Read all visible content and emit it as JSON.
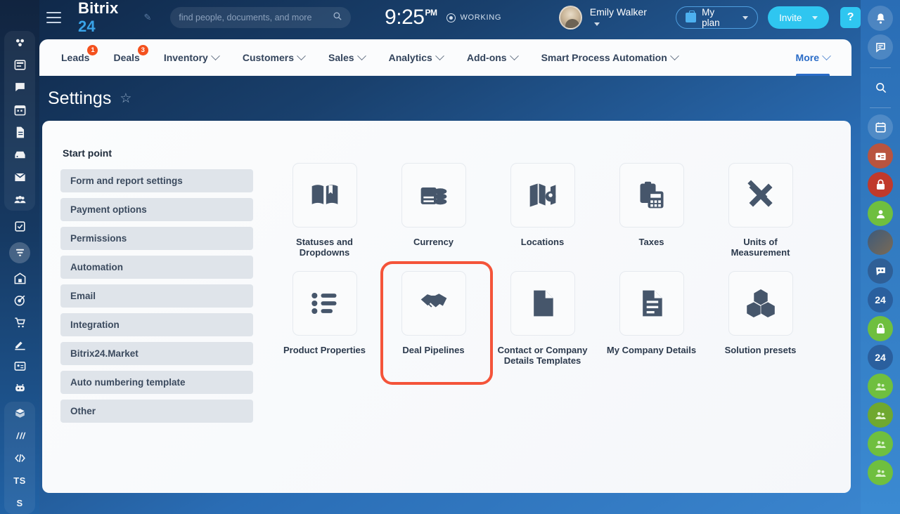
{
  "header": {
    "menu_icon": "hamburger-icon",
    "logo_text": "Bitrix",
    "logo_number": "24",
    "edit_icon": "pencil-icon",
    "search_placeholder": "find people, documents, and more",
    "search_value": "",
    "search_icon": "search-icon",
    "time": "9:25",
    "time_meridiem": "PM",
    "status_label": "WORKING",
    "status_icon": "record-dot-icon",
    "user_name": "Emily Walker",
    "avatar": "user-avatar",
    "my_plan_label": "My plan",
    "my_plan_icon": "briefcase-icon",
    "invite_label": "Invite",
    "help_label": "?"
  },
  "nav": {
    "items": [
      {
        "label": "Leads",
        "badge": "1",
        "has_dropdown": false
      },
      {
        "label": "Deals",
        "badge": "3",
        "has_dropdown": false
      },
      {
        "label": "Inventory",
        "badge": "",
        "has_dropdown": true
      },
      {
        "label": "Customers",
        "badge": "",
        "has_dropdown": true
      },
      {
        "label": "Sales",
        "badge": "",
        "has_dropdown": true
      },
      {
        "label": "Analytics",
        "badge": "",
        "has_dropdown": true
      },
      {
        "label": "Add-ons",
        "badge": "",
        "has_dropdown": true
      },
      {
        "label": "Smart Process Automation",
        "badge": "",
        "has_dropdown": true
      }
    ],
    "more_label": "More"
  },
  "page": {
    "title": "Settings",
    "favorite_icon": "star-outline-icon"
  },
  "settings_sidebar": {
    "heading": "Start point",
    "items": [
      {
        "label": "Form and report settings"
      },
      {
        "label": "Payment options"
      },
      {
        "label": "Permissions"
      },
      {
        "label": "Automation"
      },
      {
        "label": "Email"
      },
      {
        "label": "Integration"
      },
      {
        "label": "Bitrix24.Market"
      },
      {
        "label": "Auto numbering template"
      },
      {
        "label": "Other"
      }
    ]
  },
  "tiles": [
    {
      "label": "Statuses and Dropdowns",
      "icon": "open-book-icon",
      "highlighted": false
    },
    {
      "label": "Currency",
      "icon": "money-coins-icon",
      "highlighted": false
    },
    {
      "label": "Locations",
      "icon": "map-pin-icon",
      "highlighted": false
    },
    {
      "label": "Taxes",
      "icon": "clipboard-calculator-icon",
      "highlighted": false
    },
    {
      "label": "Units of Measurement",
      "icon": "ruler-pencil-icon",
      "highlighted": false
    },
    {
      "label": "Product Properties",
      "icon": "bulleted-list-icon",
      "highlighted": false
    },
    {
      "label": "Deal Pipelines",
      "icon": "handshake-icon",
      "highlighted": true
    },
    {
      "label": "Contact or Company Details Templates",
      "icon": "document-icon",
      "highlighted": false
    },
    {
      "label": "My Company Details",
      "icon": "document-lines-icon",
      "highlighted": false
    },
    {
      "label": "Solution presets",
      "icon": "cubes-icon",
      "highlighted": false
    }
  ],
  "left_rail": {
    "items": [
      {
        "icon": "bitrix-logo-icon",
        "label": ""
      },
      {
        "icon": "news-feed-icon",
        "label": ""
      },
      {
        "icon": "chat-icon",
        "label": ""
      },
      {
        "icon": "calendar-icon",
        "label": ""
      },
      {
        "icon": "document-icon",
        "label": ""
      },
      {
        "icon": "drive-icon",
        "label": ""
      },
      {
        "icon": "mail-icon",
        "label": ""
      },
      {
        "icon": "group-icon",
        "label": ""
      },
      {
        "icon": "tasks-icon",
        "label": ""
      },
      {
        "icon": "crm-funnel-icon",
        "label": ""
      },
      {
        "icon": "company-icon",
        "label": ""
      },
      {
        "icon": "target-icon",
        "label": ""
      },
      {
        "icon": "cart-icon",
        "label": ""
      },
      {
        "icon": "sign-icon",
        "label": ""
      },
      {
        "icon": "contact-card-icon",
        "label": ""
      },
      {
        "icon": "robot-icon",
        "label": ""
      },
      {
        "icon": "box-icon",
        "label": ""
      },
      {
        "icon": "analytics-icon",
        "label": ""
      },
      {
        "icon": "code-icon",
        "label": ""
      },
      {
        "icon": "ts-text-icon",
        "label": "TS"
      },
      {
        "icon": "s-text-icon",
        "label": "S"
      }
    ]
  },
  "right_rail": {
    "items": [
      {
        "icon": "bell-icon",
        "label": "",
        "color": "#ffffff"
      },
      {
        "icon": "chat-bubble-icon",
        "label": "",
        "color": "#ffffff"
      },
      {
        "icon": "search-icon",
        "label": "",
        "color": "#ffffff"
      },
      {
        "icon": "calendar-icon",
        "label": "",
        "color": "#ffffff"
      },
      {
        "icon": "contact-card-icon",
        "label": "",
        "color": "#b9543f"
      },
      {
        "icon": "lock-icon",
        "label": "",
        "color": "#c0392b"
      },
      {
        "icon": "user-icon",
        "label": "",
        "color": "#6fbf3f"
      },
      {
        "icon": "photo-avatar-icon",
        "label": "",
        "color": "#3d5a7a"
      },
      {
        "icon": "group-chat-icon",
        "label": "",
        "color": "#2f5f96"
      },
      {
        "icon": "bitrix24-badge-icon",
        "label": "24",
        "color": "#2a5f9e"
      },
      {
        "icon": "lock-icon",
        "label": "",
        "color": "#6fbf3f"
      },
      {
        "icon": "bitrix24-badge-icon",
        "label": "24",
        "color": "#2a5f9e"
      },
      {
        "icon": "users-icon",
        "label": "",
        "color": "#6fbf3f"
      },
      {
        "icon": "users-icon",
        "label": "",
        "color": "#6fa82f"
      },
      {
        "icon": "users-icon",
        "label": "",
        "color": "#6fbf3f"
      },
      {
        "icon": "users-icon",
        "label": "",
        "color": "#6fbf3f"
      }
    ]
  },
  "colors": {
    "brand_blue": "#2a6cc7",
    "accent_cyan": "#2fc6f0",
    "badge_red": "#f4511e",
    "highlight_red": "#f4543a",
    "card_bg": "#fbfcfd",
    "sidebar_item_bg": "#dfe4ea"
  }
}
